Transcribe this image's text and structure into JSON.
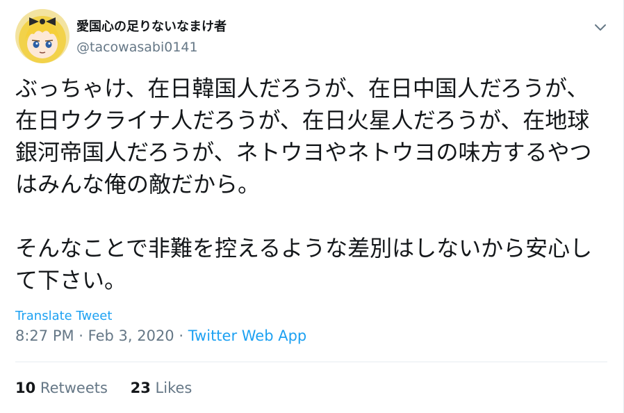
{
  "tweet": {
    "author": {
      "display_name": "愛国心の足りないなまけ者",
      "handle": "@tacowasabi0141"
    },
    "text": "ぶっちゃけ、在日韓国人だろうが、在日中国人だろうが、在日ウクライナ人だろうが、在日火星人だろうが、在地球銀河帝国人だろうが、ネトウヨやネトウヨの味方するやつはみんな俺の敵だから。\n\nそんなことで非難を控えるような差別はしないから安心して下さい。",
    "translate_label": "Translate Tweet",
    "time": "8:27 PM",
    "separator": " · ",
    "date": "Feb 3, 2020",
    "source": "Twitter Web App",
    "stats": {
      "retweets_count": "10",
      "retweets_label": "Retweets",
      "likes_count": "23",
      "likes_label": "Likes"
    }
  },
  "icons": {
    "menu": "chevron-down-icon",
    "avatar": "anime-avatar"
  },
  "colors": {
    "link": "#1da1f2",
    "text": "#14171a",
    "secondary": "#657786",
    "border": "#e6ecf0"
  }
}
